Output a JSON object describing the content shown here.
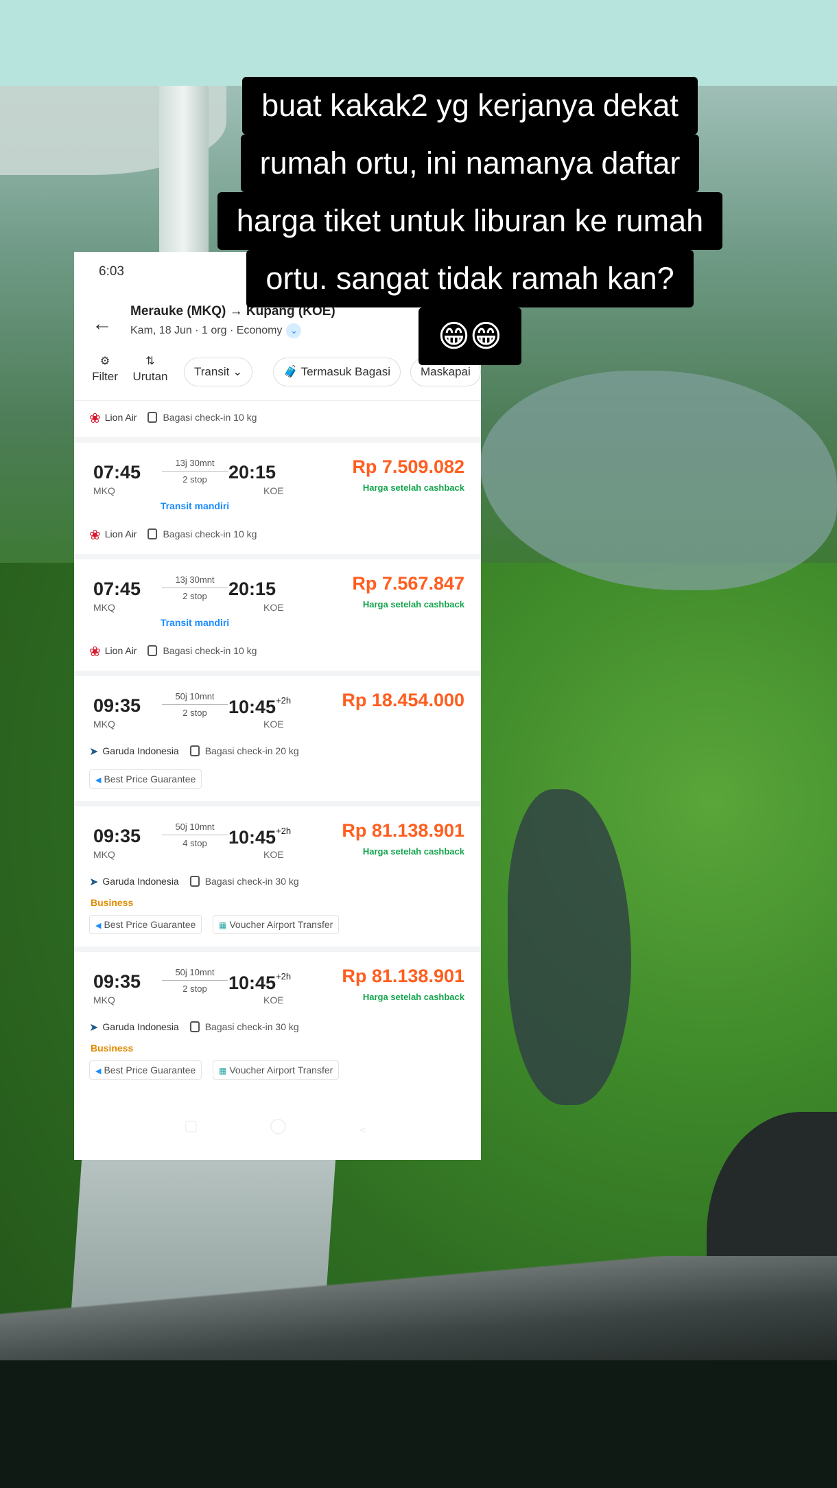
{
  "caption": {
    "lines": [
      "buat kakak2 yg kerjanya dekat",
      "rumah ortu, ini namanya daftar",
      "harga tiket untuk liburan ke rumah",
      "ortu. sangat tidak ramah kan?",
      "😁😁"
    ]
  },
  "phone": {
    "status_time": "6:03",
    "header": {
      "route": "Merauke (MKQ) → Kupang (KOE)",
      "subtitle": "Kam, 18 Jun · 1 org · Economy"
    },
    "filters": {
      "filter_label": "Filter",
      "sort_label": "Urutan",
      "transit_label": "Transit",
      "baggage_label": "Termasuk Bagasi",
      "airline_label": "Maskapai"
    },
    "top_partial": {
      "airline": "Lion Air",
      "baggage": "Bagasi check-in 10 kg"
    },
    "flights": [
      {
        "dep_time": "07:45",
        "dep_code": "MKQ",
        "duration": "13j 30mnt",
        "stops": "2 stop",
        "arr_time": "20:15",
        "arr_offset": "",
        "arr_code": "KOE",
        "price": "Rp 7.509.082",
        "cashback": "Harga setelah cashback",
        "transit_note": "Transit mandiri",
        "airline": "Lion Air",
        "baggage": "Bagasi check-in 10 kg",
        "class": "",
        "tags": []
      },
      {
        "dep_time": "07:45",
        "dep_code": "MKQ",
        "duration": "13j 30mnt",
        "stops": "2 stop",
        "arr_time": "20:15",
        "arr_offset": "",
        "arr_code": "KOE",
        "price": "Rp 7.567.847",
        "cashback": "Harga setelah cashback",
        "transit_note": "Transit mandiri",
        "airline": "Lion Air",
        "baggage": "Bagasi check-in 10 kg",
        "class": "",
        "tags": []
      },
      {
        "dep_time": "09:35",
        "dep_code": "MKQ",
        "duration": "50j 10mnt",
        "stops": "2 stop",
        "arr_time": "10:45",
        "arr_offset": "+2h",
        "arr_code": "KOE",
        "price": "Rp 18.454.000",
        "cashback": "",
        "transit_note": "",
        "airline": "Garuda Indonesia",
        "baggage": "Bagasi check-in 20 kg",
        "class": "",
        "tags": [
          "Best Price Guarantee"
        ]
      },
      {
        "dep_time": "09:35",
        "dep_code": "MKQ",
        "duration": "50j 10mnt",
        "stops": "4 stop",
        "arr_time": "10:45",
        "arr_offset": "+2h",
        "arr_code": "KOE",
        "price": "Rp 81.138.901",
        "cashback": "Harga setelah cashback",
        "transit_note": "",
        "airline": "Garuda Indonesia",
        "baggage": "Bagasi check-in 30 kg",
        "class": "Business",
        "tags": [
          "Best Price Guarantee",
          "Voucher Airport Transfer"
        ]
      },
      {
        "dep_time": "09:35",
        "dep_code": "MKQ",
        "duration": "50j 10mnt",
        "stops": "2 stop",
        "arr_time": "10:45",
        "arr_offset": "+2h",
        "arr_code": "KOE",
        "price": "Rp 81.138.901",
        "cashback": "Harga setelah cashback",
        "transit_note": "",
        "airline": "Garuda Indonesia",
        "baggage": "Bagasi check-in 30 kg",
        "class": "Business",
        "tags": [
          "Best Price Guarantee",
          "Voucher Airport Transfer"
        ]
      }
    ]
  }
}
